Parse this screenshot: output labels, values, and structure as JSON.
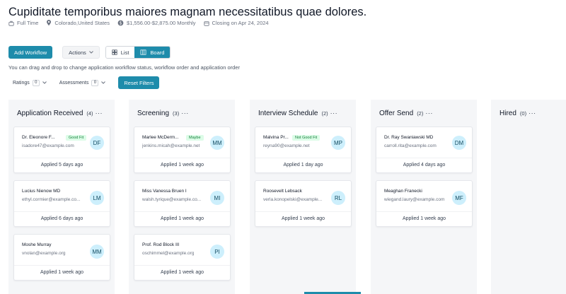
{
  "job": {
    "title": "Cupiditate temporibus maiores magnam necessitatibus quae dolores.",
    "type": "Full Time",
    "location": "Colorado,United States",
    "salary": "$1,556.00-$2,875.00 Monthly",
    "closing": "Closing on Apr 24, 2024"
  },
  "toolbar": {
    "add_workflow": "Add Workflow",
    "actions": "Actions",
    "list": "List",
    "board": "Board"
  },
  "hint": "You can drag and drop to change application workflow status, workflow order and application order",
  "filters": {
    "ratings_label": "Ratings",
    "ratings_count": "0",
    "assessments_label": "Assessments",
    "assessments_count": "0",
    "reset": "Reset Filters"
  },
  "columns": [
    {
      "name": "Application Received",
      "count": "(4)",
      "more": "···",
      "cards": [
        {
          "name": "Dr. Eleonore F...",
          "badge": "Good Fit",
          "email": "isadore47@example.com",
          "initials": "DF",
          "applied": "Applied 5 days ago"
        },
        {
          "name": "Lucius Nienow MD",
          "badge": "",
          "email": "ethyl.cormier@example.co...",
          "initials": "LM",
          "applied": "Applied 6 days ago"
        },
        {
          "name": "Moshe Murray",
          "badge": "",
          "email": "vnolan@example.org",
          "initials": "MM",
          "applied": "Applied 1 week ago"
        }
      ]
    },
    {
      "name": "Screening",
      "count": "(3)",
      "more": "···",
      "cards": [
        {
          "name": "Marlee McDerm...",
          "badge": "Maybe",
          "email": "jenkins.micah@example.net",
          "initials": "MM",
          "applied": "Applied 1 week ago"
        },
        {
          "name": "Miss Vanessa Bruen I",
          "badge": "",
          "email": "walsh.tyrique@example.co...",
          "initials": "MI",
          "applied": "Applied 1 week ago"
        },
        {
          "name": "Prof. Rod Block III",
          "badge": "",
          "email": "oschimmel@example.org",
          "initials": "PI",
          "applied": "Applied 1 week ago"
        }
      ]
    },
    {
      "name": "Interview Schedule",
      "count": "(2)",
      "more": "···",
      "cards": [
        {
          "name": "Malvina Pr...",
          "badge": "Not Good Fit",
          "email": "reyna90@example.net",
          "initials": "MP",
          "applied": "Applied 1 day ago"
        },
        {
          "name": "Roosevelt Lebsack",
          "badge": "",
          "email": "verla.konopelski@example...",
          "initials": "RL",
          "applied": "Applied 1 week ago"
        }
      ]
    },
    {
      "name": "Offer Send",
      "count": "(2)",
      "more": "···",
      "cards": [
        {
          "name": "Dr. Ray Swaniawski MD",
          "badge": "",
          "email": "carroll.rita@example.com",
          "initials": "DM",
          "applied": "Applied 4 days ago"
        },
        {
          "name": "Meaghan Franecki",
          "badge": "",
          "email": "wiegand.laury@example.com",
          "initials": "MF",
          "applied": "Applied 1 week ago"
        }
      ]
    },
    {
      "name": "Hired",
      "count": "(0)",
      "more": "···",
      "cards": []
    }
  ],
  "colors": {
    "accent": "#1e8cab",
    "avatar_bg": "#cdeffc",
    "badge_bg": "#dcfce7",
    "badge_text": "#16803c"
  }
}
